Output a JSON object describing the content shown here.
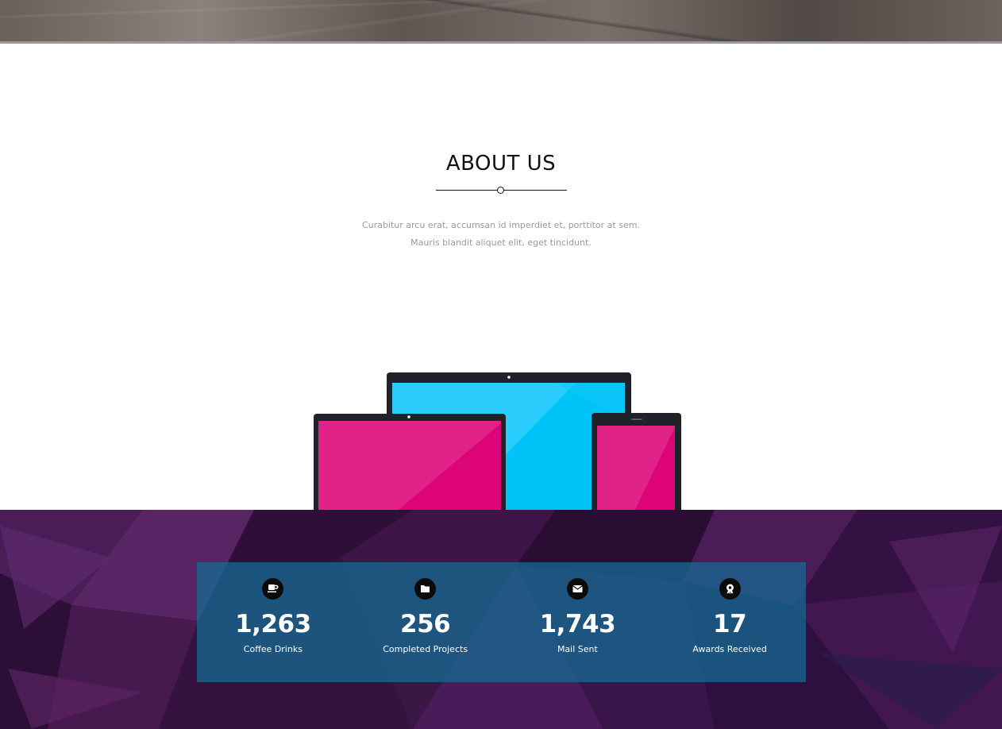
{
  "about": {
    "title": "ABOUT US",
    "text_line1": "Curabitur arcu erat, accumsan id imperdiet et, porttitor at sem.",
    "text_line2": "Mauris blandit aliquet elit, eget tincidunt."
  },
  "stats": [
    {
      "icon": "coffee-icon",
      "value": "1,263",
      "label": "Coffee Drinks"
    },
    {
      "icon": "folder-icon",
      "value": "256",
      "label": "Completed Projects"
    },
    {
      "icon": "mail-icon",
      "value": "1,743",
      "label": "Mail Sent"
    },
    {
      "icon": "award-icon",
      "value": "17",
      "label": "Awards Received"
    }
  ],
  "colors": {
    "laptop_screen": "#00c3f8",
    "tablet_screen": "#dd0479",
    "device_frame": "#1f2229",
    "stats_overlay": "#146e96",
    "stats_background": "#3b1746"
  }
}
